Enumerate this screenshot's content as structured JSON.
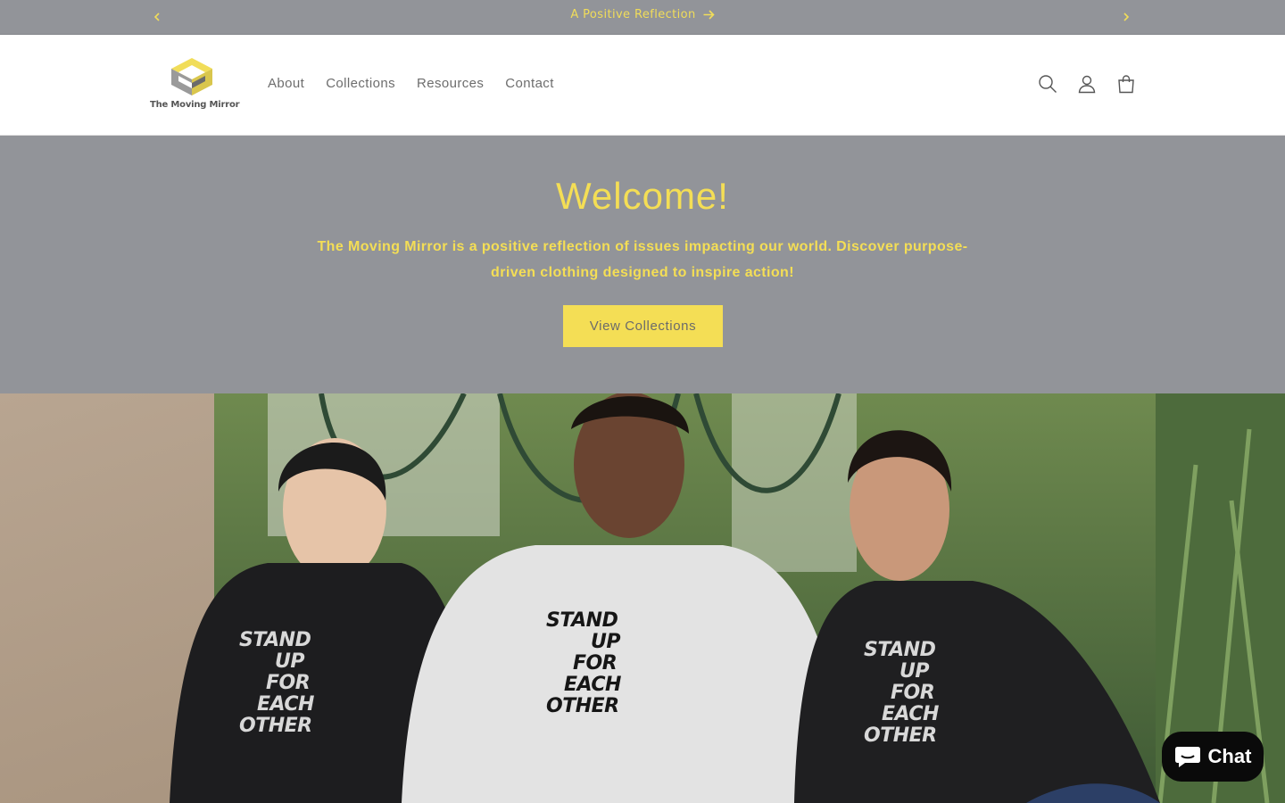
{
  "announcement": {
    "message": "A Positive Reflection",
    "prev_icon": "chevron-left-icon",
    "next_icon": "chevron-right-icon",
    "arrow_icon": "arrow-right-icon"
  },
  "header": {
    "logo_text": "The Moving Mirror",
    "menu": [
      {
        "label": "About"
      },
      {
        "label": "Collections"
      },
      {
        "label": "Resources"
      },
      {
        "label": "Contact"
      }
    ],
    "icons": [
      "search-icon",
      "account-icon",
      "cart-icon"
    ]
  },
  "hero": {
    "title": "Welcome!",
    "subtitle": "The Moving Mirror is a positive reflection of issues impacting our world. Discover purpose-driven clothing designed to inspire action!",
    "button_label": "View Collections"
  },
  "photo": {
    "hoodie_lines": [
      "STAND",
      "UP",
      "FOR",
      "EACH",
      "OTHER"
    ]
  },
  "chat": {
    "label": "Chat",
    "icon": "chat-bubble-icon"
  },
  "colors": {
    "banner_gray": "#929499",
    "accent_yellow": "#f4de55",
    "nav_text": "#6d6d6d"
  }
}
